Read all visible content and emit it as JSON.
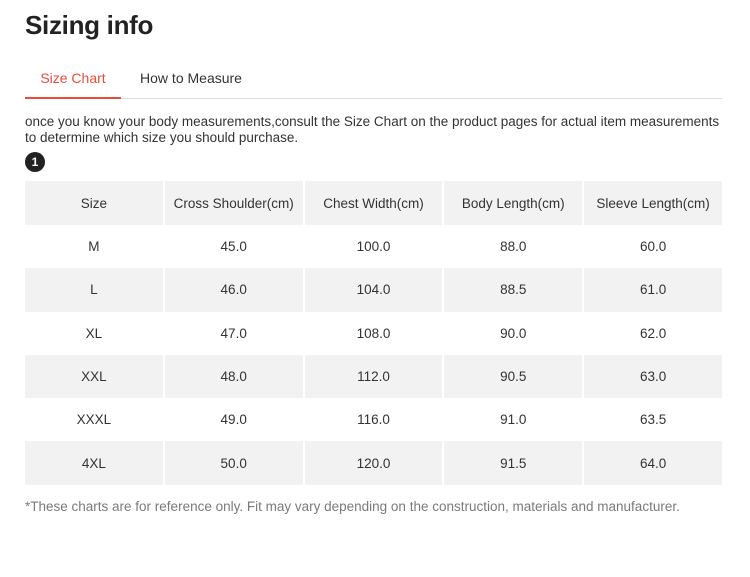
{
  "page": {
    "title": "Sizing info"
  },
  "tabs": [
    {
      "label": "Size Chart",
      "active": true
    },
    {
      "label": "How to Measure",
      "active": false
    }
  ],
  "intro_text": "once you know your body measurements,consult the Size Chart on the product pages for actual item measurements to determine which size you should purchase.",
  "step_badge": "1",
  "table": {
    "headers": [
      "Size",
      "Cross Shoulder(cm)",
      "Chest Width(cm)",
      "Body Length(cm)",
      "Sleeve Length(cm)"
    ],
    "rows": [
      [
        "M",
        "45.0",
        "100.0",
        "88.0",
        "60.0"
      ],
      [
        "L",
        "46.0",
        "104.0",
        "88.5",
        "61.0"
      ],
      [
        "XL",
        "47.0",
        "108.0",
        "90.0",
        "62.0"
      ],
      [
        "XXL",
        "48.0",
        "112.0",
        "90.5",
        "63.0"
      ],
      [
        "XXXL",
        "49.0",
        "116.0",
        "91.0",
        "63.5"
      ],
      [
        "4XL",
        "50.0",
        "120.0",
        "91.5",
        "64.0"
      ]
    ]
  },
  "footnote": "*These charts are for reference only. Fit may vary depending on the construction, materials and manufacturer.",
  "colors": {
    "accent": "#e94d3a",
    "row_shade": "#f2f2f2",
    "note_text": "#7a7a7a"
  }
}
